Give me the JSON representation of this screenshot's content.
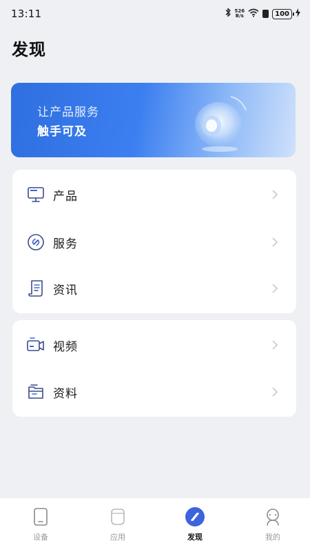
{
  "status_bar": {
    "time": "13:11",
    "net_speed_value": "526",
    "net_speed_unit": "B/s",
    "battery": "100"
  },
  "header": {
    "title": "发现"
  },
  "banner": {
    "line1": "让产品服务",
    "line2": "触手可及",
    "colors": {
      "start": "#2f6fe0",
      "end": "#cfe1fb"
    }
  },
  "menu_group_1": [
    {
      "label": "产品",
      "icon": "monitor-icon"
    },
    {
      "label": "服务",
      "icon": "link-circle-icon"
    },
    {
      "label": "资讯",
      "icon": "document-icon"
    }
  ],
  "menu_group_2": [
    {
      "label": "视频",
      "icon": "video-camera-icon"
    },
    {
      "label": "资料",
      "icon": "folder-icon"
    }
  ],
  "bottom_nav": [
    {
      "label": "设备",
      "icon": "phone-device-icon",
      "active": false
    },
    {
      "label": "应用",
      "icon": "app-icon",
      "active": false
    },
    {
      "label": "发现",
      "icon": "compass-icon",
      "active": true
    },
    {
      "label": "我的",
      "icon": "user-icon",
      "active": false
    }
  ],
  "colors": {
    "accent": "#3d63dd",
    "icon_stroke": "#3b4a8a",
    "background": "#eef0f4"
  }
}
